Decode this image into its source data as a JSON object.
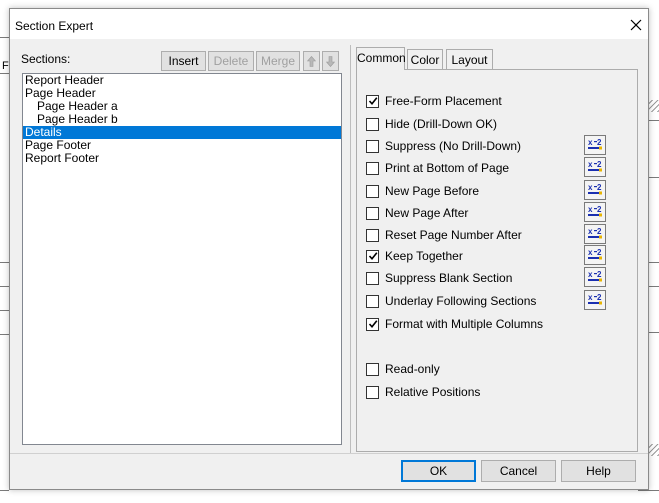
{
  "window": {
    "title": "Section Expert"
  },
  "background": {
    "left_fragment": "F"
  },
  "sections": {
    "label": "Sections:",
    "buttons": {
      "insert": "Insert",
      "delete": "Delete",
      "merge": "Merge"
    },
    "items": [
      {
        "label": "Report Header",
        "indent": false,
        "selected": false
      },
      {
        "label": "Page Header",
        "indent": false,
        "selected": false
      },
      {
        "label": "Page Header a",
        "indent": true,
        "selected": false
      },
      {
        "label": "Page Header b",
        "indent": true,
        "selected": false
      },
      {
        "label": "Details",
        "indent": false,
        "selected": true
      },
      {
        "label": "Page Footer",
        "indent": false,
        "selected": false
      },
      {
        "label": "Report Footer",
        "indent": false,
        "selected": false
      }
    ]
  },
  "tabs": [
    {
      "label": "Common",
      "active": true
    },
    {
      "label": "Color",
      "active": false
    },
    {
      "label": "Layout",
      "active": false
    }
  ],
  "options": [
    {
      "label": "Free-Form Placement",
      "checked": true,
      "formula": false
    },
    {
      "label": "Hide (Drill-Down OK)",
      "checked": false,
      "formula": false
    },
    {
      "label": "Suppress (No Drill-Down)",
      "checked": false,
      "formula": true
    },
    {
      "label": "Print at Bottom of Page",
      "checked": false,
      "formula": true
    },
    {
      "label": "New Page Before",
      "checked": false,
      "formula": true
    },
    {
      "label": "New Page After",
      "checked": false,
      "formula": true
    },
    {
      "label": "Reset Page Number After",
      "checked": false,
      "formula": true
    },
    {
      "label": "Keep Together",
      "checked": true,
      "formula": true
    },
    {
      "label": "Suppress Blank Section",
      "checked": false,
      "formula": true
    },
    {
      "label": "Underlay Following Sections",
      "checked": false,
      "formula": true
    },
    {
      "label": "Format with Multiple Columns",
      "checked": true,
      "formula": false
    },
    {
      "label": "Read-only",
      "checked": false,
      "formula": false
    },
    {
      "label": "Relative Positions",
      "checked": false,
      "formula": false
    }
  ],
  "formula_icon": {
    "name": "formula-x2-icon",
    "text": "x-2"
  },
  "footer": {
    "ok": "OK",
    "cancel": "Cancel",
    "help": "Help"
  },
  "colors": {
    "selection": "#0078d7",
    "dialog_bg": "#f0f0f0"
  }
}
